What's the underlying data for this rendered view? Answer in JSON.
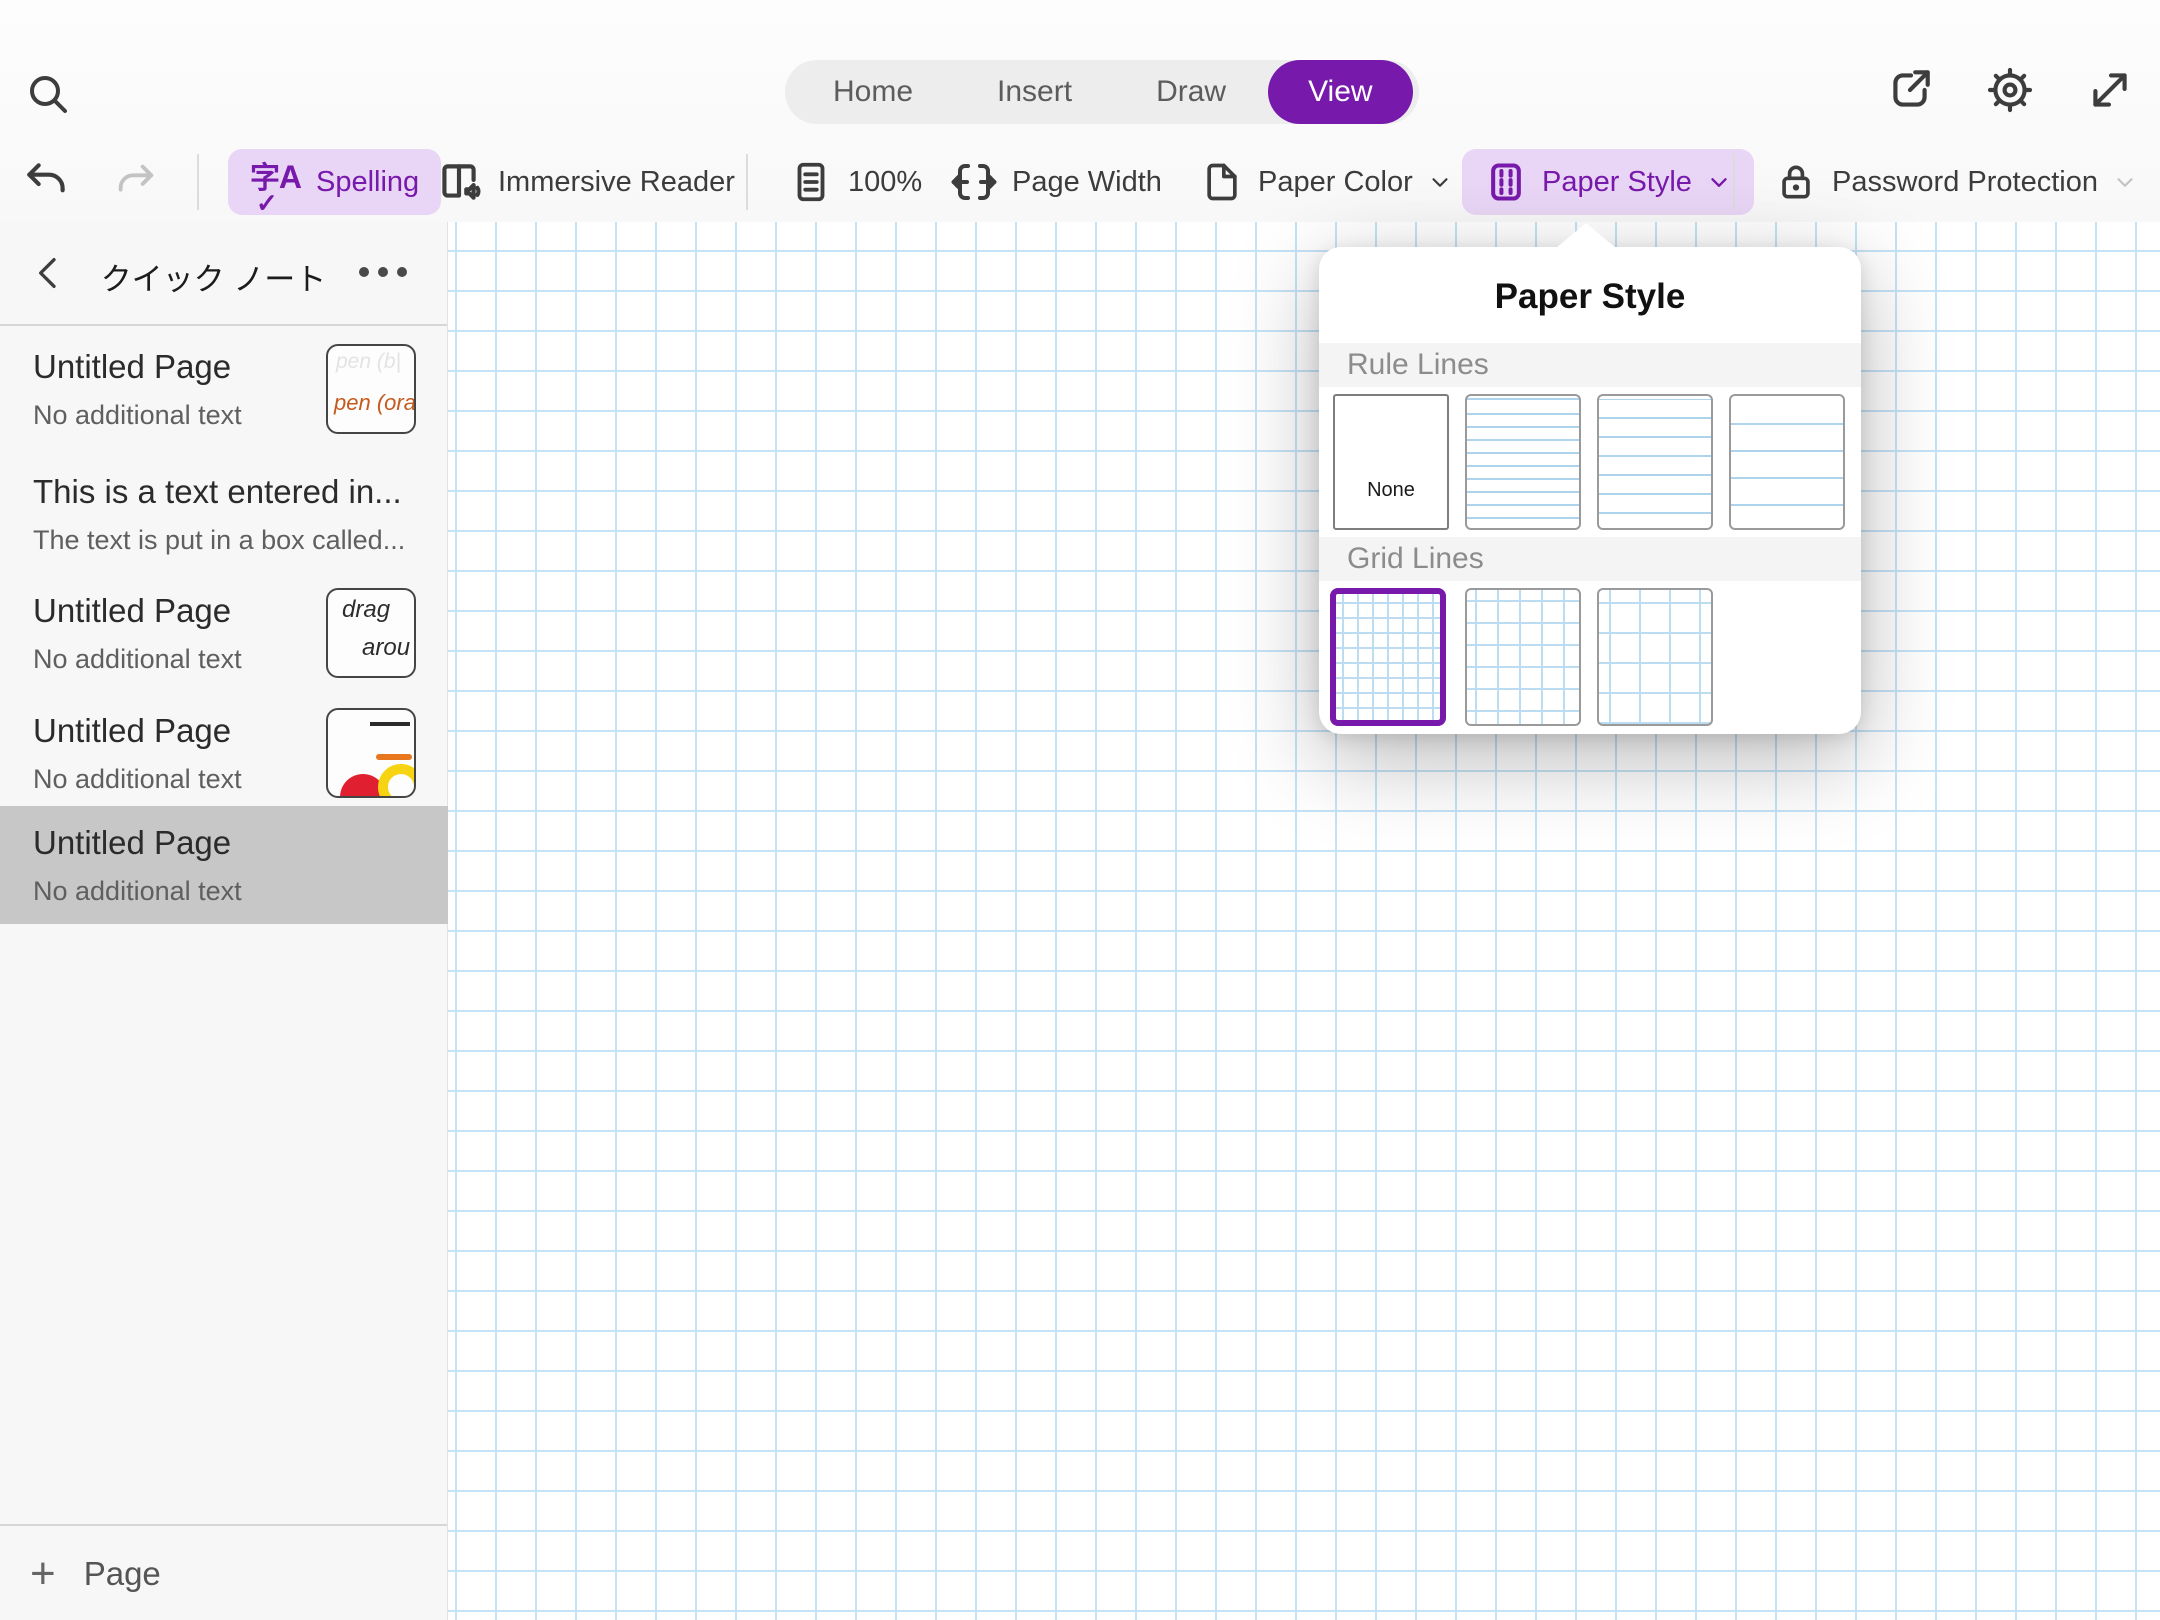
{
  "colors": {
    "accent": "#7719aa",
    "accent_light_bg": "#e9d5f5",
    "canvas_grid_blue": "#c5e3f7",
    "selected_page_gray": "#c7c7c7",
    "popup_line_blue": "#aed3ec"
  },
  "topbar": {
    "tabs": [
      {
        "label": "Home"
      },
      {
        "label": "Insert"
      },
      {
        "label": "Draw"
      },
      {
        "label": "View"
      }
    ],
    "active_tab": "View"
  },
  "toolbar": {
    "spelling_label": "Spelling",
    "immersive_reader_label": "Immersive Reader",
    "zoom_level": "100%",
    "page_width_label": "Page Width",
    "paper_color_label": "Paper Color",
    "paper_style_label": "Paper Style",
    "password_protection_label": "Password Protection"
  },
  "sidebar": {
    "title": "クイック ノート",
    "items": [
      {
        "title": "Untitled Page",
        "subtitle": "No additional text",
        "thumb_line1": "pen (b|",
        "thumb_line2": "pen (ora"
      },
      {
        "title": "This is a text entered in...",
        "subtitle": "The text is put in a box called..."
      },
      {
        "title": "Untitled Page",
        "subtitle": "No additional text",
        "thumb_line1": "drag",
        "thumb_line2": "arou"
      },
      {
        "title": "Untitled Page",
        "subtitle": "No additional text"
      },
      {
        "title": "Untitled Page",
        "subtitle": "No additional text",
        "selected": true
      }
    ],
    "add_page_label": "Page"
  },
  "popup": {
    "title": "Paper Style",
    "rule_section_label": "Rule Lines",
    "grid_section_label": "Grid Lines",
    "none_option_label": "None",
    "selected_option": "grid-small"
  }
}
